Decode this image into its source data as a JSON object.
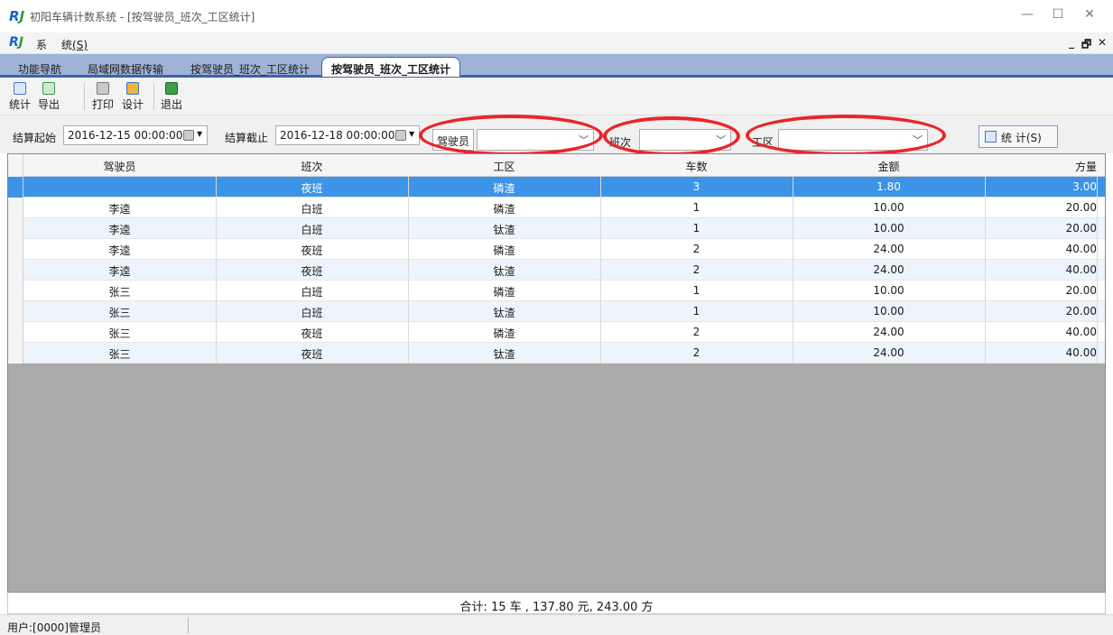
{
  "window": {
    "logo": "R",
    "logo_j": "J",
    "title": "初阳车辆计数系统 - [按驾驶员_班次_工区统计]",
    "minimize": "—",
    "maximize": "☐",
    "close": "✕"
  },
  "menu": {
    "logo": "R",
    "logo_j": "J",
    "system_label": "系",
    "stats_label": "统",
    "stats_accel": "(S)",
    "mdi_minimize": "_",
    "mdi_restore": "🗗",
    "mdi_close": "✕"
  },
  "tabs": [
    {
      "label": "功能导航"
    },
    {
      "label": "局域网数据传输"
    },
    {
      "label": "按驾驶员_班次_工区统计"
    },
    {
      "label": "按驾驶员_班次_工区统计"
    }
  ],
  "toolbar": {
    "stat": "统计",
    "export": "导出",
    "print": "打印",
    "design": "设计",
    "exit": "退出"
  },
  "filters": {
    "start_label": "结算起始",
    "start_value": "2016-12-15 00:00:00",
    "end_label": "结算截止",
    "end_value": "2016-12-18 00:00:00",
    "driver_label": "驾驶员",
    "shift_label": "班次",
    "area_label": "工区",
    "stat_button": "统 计(S)"
  },
  "table": {
    "columns": [
      "驾驶员",
      "班次",
      "工区",
      "车数",
      "金额",
      "方量"
    ],
    "rows": [
      [
        "",
        "夜班",
        "磷渣",
        "3",
        "1.80",
        "3.00"
      ],
      [
        "李逵",
        "白班",
        "磷渣",
        "1",
        "10.00",
        "20.00"
      ],
      [
        "李逵",
        "白班",
        "钛渣",
        "1",
        "10.00",
        "20.00"
      ],
      [
        "李逵",
        "夜班",
        "磷渣",
        "2",
        "24.00",
        "40.00"
      ],
      [
        "李逵",
        "夜班",
        "钛渣",
        "2",
        "24.00",
        "40.00"
      ],
      [
        "张三",
        "白班",
        "磷渣",
        "1",
        "10.00",
        "20.00"
      ],
      [
        "张三",
        "白班",
        "钛渣",
        "1",
        "10.00",
        "20.00"
      ],
      [
        "张三",
        "夜班",
        "磷渣",
        "2",
        "24.00",
        "40.00"
      ],
      [
        "张三",
        "夜班",
        "钛渣",
        "2",
        "24.00",
        "40.00"
      ]
    ],
    "selected_row": 0
  },
  "summary": "合计: 15 车 , 137.80 元, 243.00 方",
  "status": {
    "user": "用户:[0000]管理员"
  },
  "colors": {
    "tab_strip": "#9fb3d6",
    "selection": "#3c94e8",
    "highlight_ellipse": "#e8262a"
  }
}
